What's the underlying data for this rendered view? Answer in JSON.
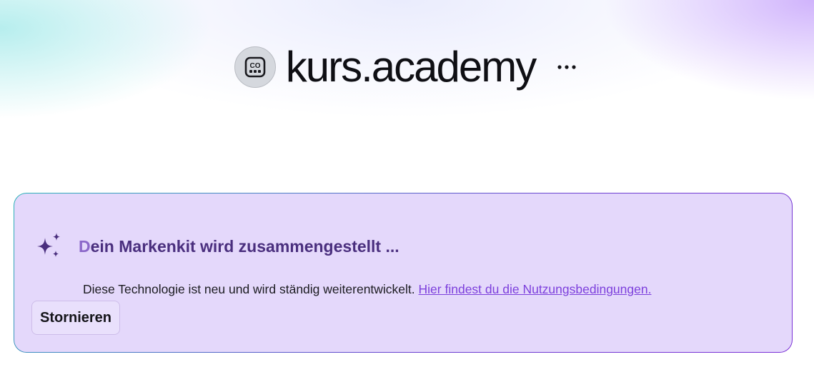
{
  "brand": {
    "name": "kurs.academy",
    "avatar_initials": "CO"
  },
  "panel": {
    "title": "Dein Markenkit wird zusammengestellt ...",
    "info_text": "Diese Technologie ist neu und wird ständig weiterentwickelt. ",
    "terms_link": "Hier findest du die Nutzungsbedingungen.",
    "cancel_label": "Stornieren"
  },
  "icons": {
    "brand": "brand-logo-icon",
    "more": "more-horizontal-icon",
    "sparkle": "sparkle-icon"
  },
  "colors": {
    "panel_background": "#e4d8fb",
    "title_color": "#4a2f7e",
    "link_color": "#7c3fdc",
    "brand_text": "#0f0f14"
  }
}
